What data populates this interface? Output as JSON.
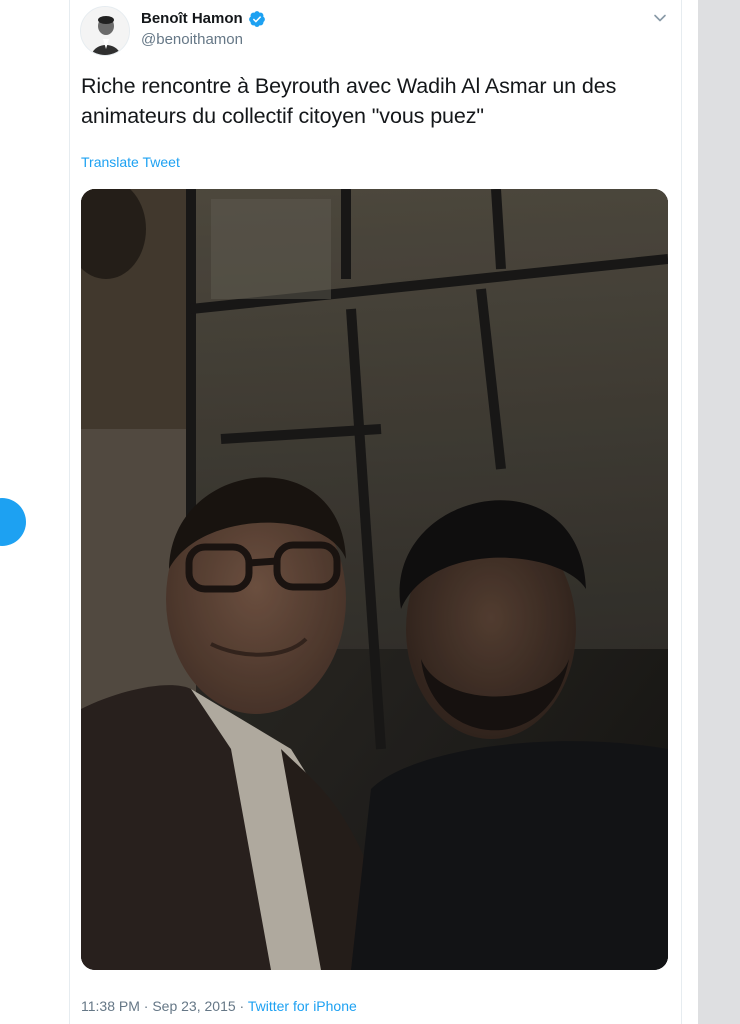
{
  "tweet": {
    "author": {
      "display_name": "Benoît Hamon",
      "handle": "@benoithamon",
      "verified": true
    },
    "text": "Riche rencontre à Beyrouth avec Wadih Al Asmar un des animateurs du collectif citoyen \"vous puez\"",
    "translate_label": "Translate Tweet",
    "photo_alt": "Selfie of two men in a dimly lit room with tall windows",
    "footer": {
      "time": "11:38 PM",
      "separator": " · ",
      "date": "Sep 23, 2015",
      "separator2": " · ",
      "source": "Twitter for iPhone"
    }
  },
  "icons": {
    "verified": "verified-badge-icon",
    "menu": "chevron-down-icon"
  },
  "colors": {
    "accent": "#1da1f2",
    "text_primary": "#14171a",
    "text_secondary": "#657786",
    "gutter": "#dedfe1"
  }
}
